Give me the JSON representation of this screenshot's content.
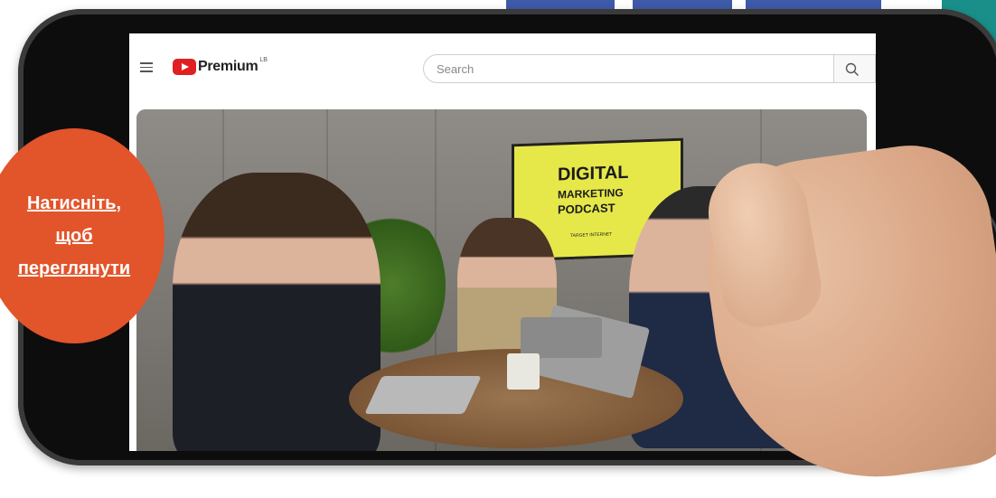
{
  "youtube": {
    "logo_text": "Premium",
    "logo_sup": "LB",
    "search_placeholder": "Search"
  },
  "video": {
    "sign": {
      "line1": "DIGITAL",
      "line2": "MARKETING",
      "line3": "PODCAST",
      "line4": "TARGET INTERNET"
    }
  },
  "cta": {
    "line1": "Натисніть,",
    "line2": "щоб",
    "line3": "переглянути"
  },
  "colors": {
    "accent": "#e2542a",
    "youtube_red": "#e02020",
    "teal": "#1a8f8a",
    "sign_yellow": "#e6e84a"
  },
  "icons": [
    "menu-icon",
    "youtube-logo-icon",
    "search-icon"
  ]
}
